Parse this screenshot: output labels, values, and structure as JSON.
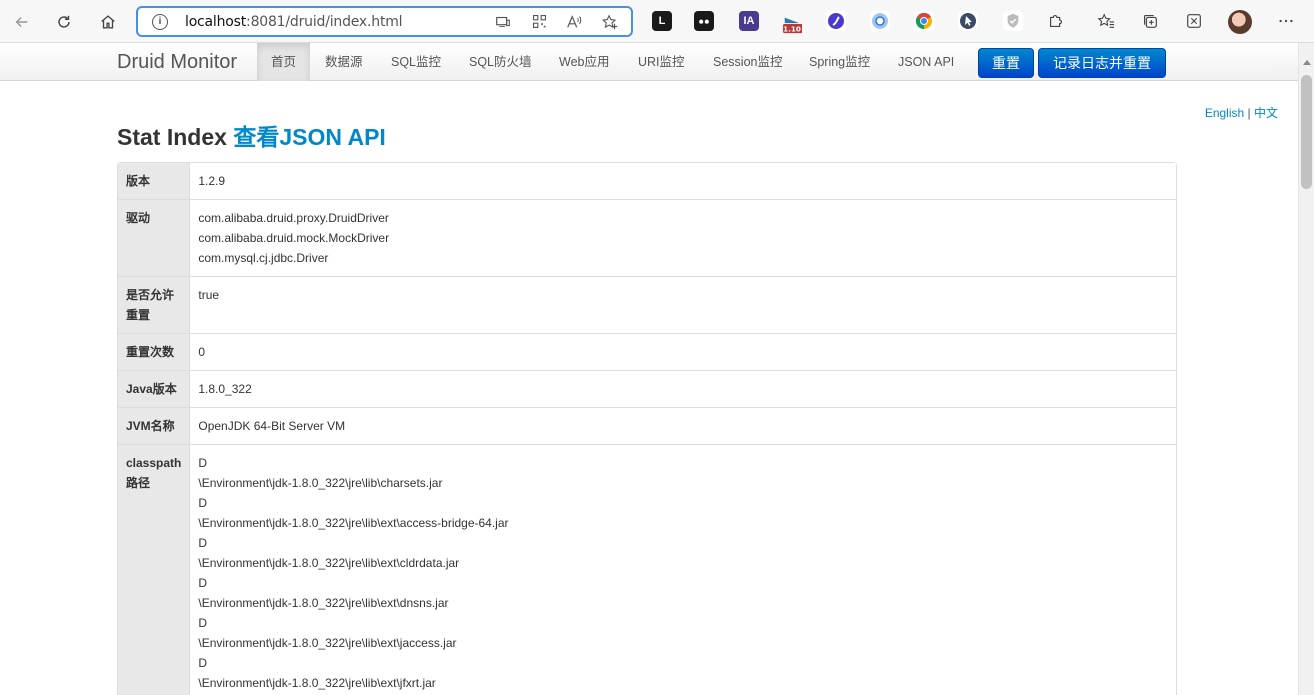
{
  "browser": {
    "url_host": "localhost",
    "url_rest": ":8081/druid/index.html",
    "ext_badge": "1.10"
  },
  "druid": {
    "brand": "Druid Monitor",
    "nav": [
      "首页",
      "数据源",
      "SQL监控",
      "SQL防火墙",
      "Web应用",
      "URI监控",
      "Session监控",
      "Spring监控",
      "JSON API"
    ],
    "active_nav": "首页",
    "reset_button": "重置",
    "log_reset_button": "记录日志并重置"
  },
  "lang": {
    "english": "English",
    "separator": "|",
    "chinese": "中文"
  },
  "title": {
    "main": "Stat Index",
    "link": "查看JSON API"
  },
  "table": {
    "rows": [
      {
        "key": "版本",
        "lines": [
          "1.2.9"
        ]
      },
      {
        "key": "驱动",
        "lines": [
          "com.alibaba.druid.proxy.DruidDriver",
          "com.alibaba.druid.mock.MockDriver",
          "com.mysql.cj.jdbc.Driver"
        ]
      },
      {
        "key": "是否允许重置",
        "lines": [
          "true"
        ]
      },
      {
        "key": "重置次数",
        "lines": [
          "0"
        ]
      },
      {
        "key": "Java版本",
        "lines": [
          "1.8.0_322"
        ]
      },
      {
        "key": "JVM名称",
        "lines": [
          "OpenJDK 64-Bit Server VM"
        ]
      },
      {
        "key": "classpath路径",
        "lines": [
          "D",
          "\\Environment\\jdk-1.8.0_322\\jre\\lib\\charsets.jar",
          "D",
          "\\Environment\\jdk-1.8.0_322\\jre\\lib\\ext\\access-bridge-64.jar",
          "D",
          "\\Environment\\jdk-1.8.0_322\\jre\\lib\\ext\\cldrdata.jar",
          "D",
          "\\Environment\\jdk-1.8.0_322\\jre\\lib\\ext\\dnsns.jar",
          "D",
          "\\Environment\\jdk-1.8.0_322\\jre\\lib\\ext\\jaccess.jar",
          "D",
          "\\Environment\\jdk-1.8.0_322\\jre\\lib\\ext\\jfxrt.jar"
        ]
      }
    ]
  }
}
